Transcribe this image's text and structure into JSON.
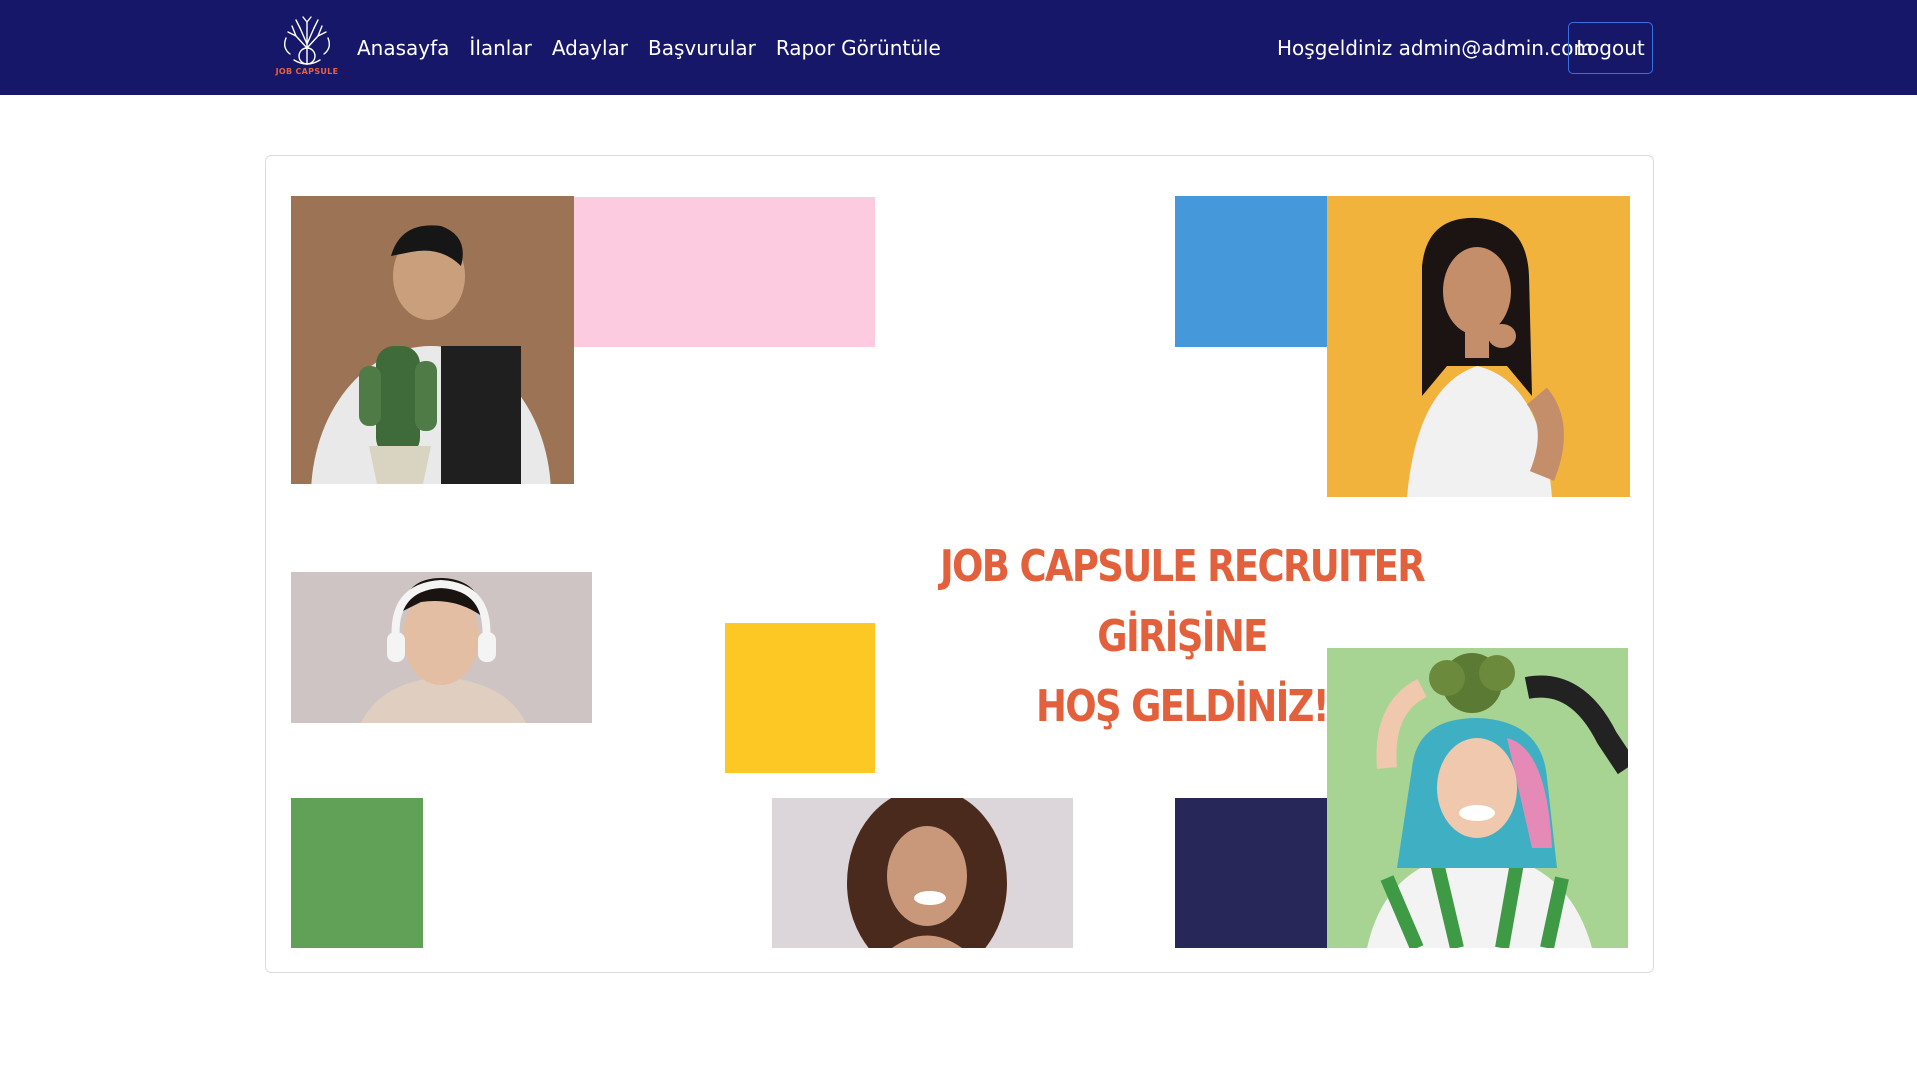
{
  "brand": {
    "logo_text": "JOB CAPSULE"
  },
  "nav": {
    "links": [
      "Anasayfa",
      "İlanlar",
      "Adaylar",
      "Başvurular",
      "Rapor Görüntüle"
    ]
  },
  "user": {
    "welcome": "Hoşgeldiniz admin@admin.com",
    "logout_label": "Logout"
  },
  "hero": {
    "line1": "JOB CAPSULE RECRUITER GİRİŞİNE",
    "line2": "HOŞ GELDİNİZ!"
  },
  "colors": {
    "navbar": "#17176a",
    "accent": "#e2613c",
    "pink": "#fccbe0",
    "blue": "#4599db",
    "yellow": "#fdc824",
    "green": "#61a157",
    "navy": "#27275a"
  }
}
